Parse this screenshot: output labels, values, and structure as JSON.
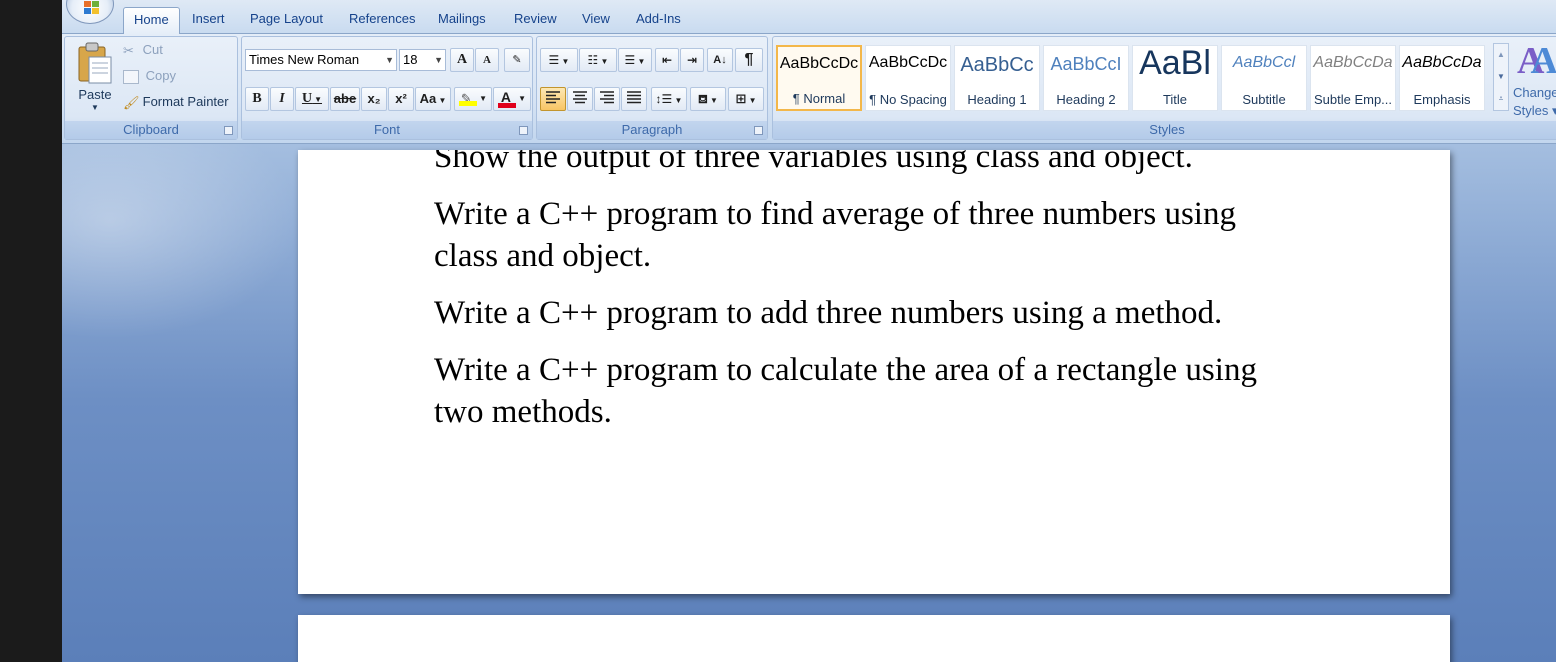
{
  "tabs": [
    {
      "label": "Home",
      "active": true
    },
    {
      "label": "Insert"
    },
    {
      "label": "Page Layout"
    },
    {
      "label": "References"
    },
    {
      "label": "Mailings"
    },
    {
      "label": "Review"
    },
    {
      "label": "View"
    },
    {
      "label": "Add-Ins"
    }
  ],
  "clipboard": {
    "paste_label": "Paste",
    "cut_label": "Cut",
    "copy_label": "Copy",
    "format_painter_label": "Format Painter",
    "group_label": "Clipboard"
  },
  "font": {
    "font_name": "Times New Roman",
    "font_size": "18",
    "group_label": "Font",
    "bold": "B",
    "italic": "I",
    "underline": "U",
    "strike": "abe",
    "subscript": "x₂",
    "superscript": "x²",
    "change_case": "Aa",
    "font_color_letter": "A",
    "grow": "A",
    "shrink": "A",
    "highlight_color": "#ffff00",
    "font_color": "#e0001b"
  },
  "paragraph": {
    "group_label": "Paragraph",
    "sort_label": "A↓",
    "show_marks": "¶"
  },
  "styles": {
    "group_label": "Styles",
    "change_styles_label_1": "Change",
    "change_styles_label_2": "Styles",
    "items": [
      {
        "sample": "AaBbCcDc",
        "name": "¶ Normal",
        "selected": true
      },
      {
        "sample": "AaBbCcDc",
        "name": "¶ No Spacing"
      },
      {
        "sample": "AaBbCc",
        "name": "Heading 1"
      },
      {
        "sample": "AaBbCcI",
        "name": "Heading 2"
      },
      {
        "sample": "AaBl",
        "name": "Title"
      },
      {
        "sample": "AaBbCcl",
        "name": "Subtitle"
      },
      {
        "sample": "AaBbCcDa",
        "name": "Subtle Emp..."
      },
      {
        "sample": "AaBbCcDa",
        "name": "Emphasis"
      }
    ]
  },
  "document": {
    "lines": [
      "Show the output of three variables using class and object.",
      "Write a C++ program to find average of three numbers using",
      "class and object.",
      "Write a C++ program to add three numbers using a method.",
      "Write a C++ program to calculate the area of a rectangle using",
      "two methods."
    ]
  }
}
